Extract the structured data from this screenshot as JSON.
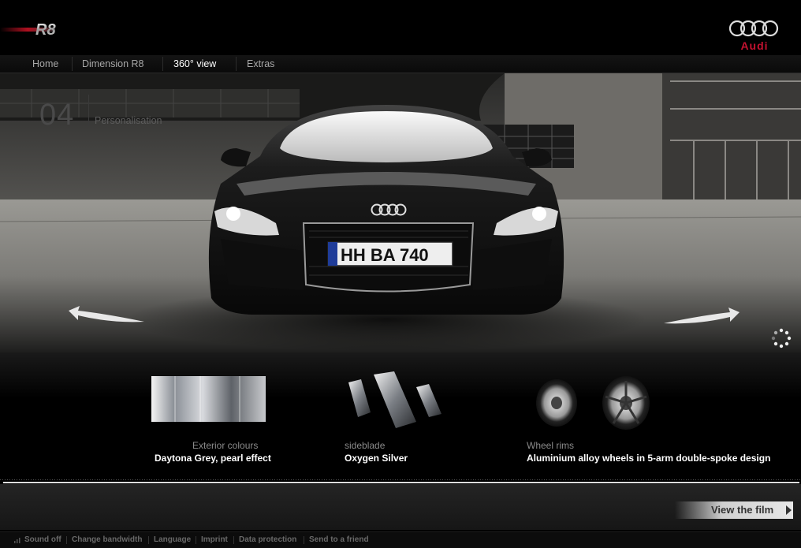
{
  "brand": {
    "model_logo": "R8",
    "maker_logo": "Audi"
  },
  "nav": {
    "items": [
      "Home",
      "Dimension R8",
      "360° view",
      "Extras"
    ],
    "active": "360° view"
  },
  "car": {
    "license_plate": "HH BA 740"
  },
  "options": [
    {
      "title": "Exterior colours",
      "value": "Daytona Grey, pearl effect"
    },
    {
      "title": "sideblade",
      "value": "Oxygen Silver"
    },
    {
      "title": "Wheel rims",
      "value": "Aluminium alloy wheels in 5-arm double-spoke design"
    }
  ],
  "step": {
    "number": "04",
    "label": "Personalisation"
  },
  "film_button": {
    "label": "View the film"
  },
  "footer": {
    "items": [
      "Sound off",
      "Change bandwidth",
      "Language",
      "Imprint",
      "Data protection",
      "Send to a friend"
    ]
  },
  "colors": {
    "accent": "#c41230",
    "background": "#000000"
  },
  "icons": {
    "rotate_left": "curved-arrow-left-icon",
    "rotate_right": "curved-arrow-right-icon",
    "loading": "loading-spinner-icon"
  }
}
